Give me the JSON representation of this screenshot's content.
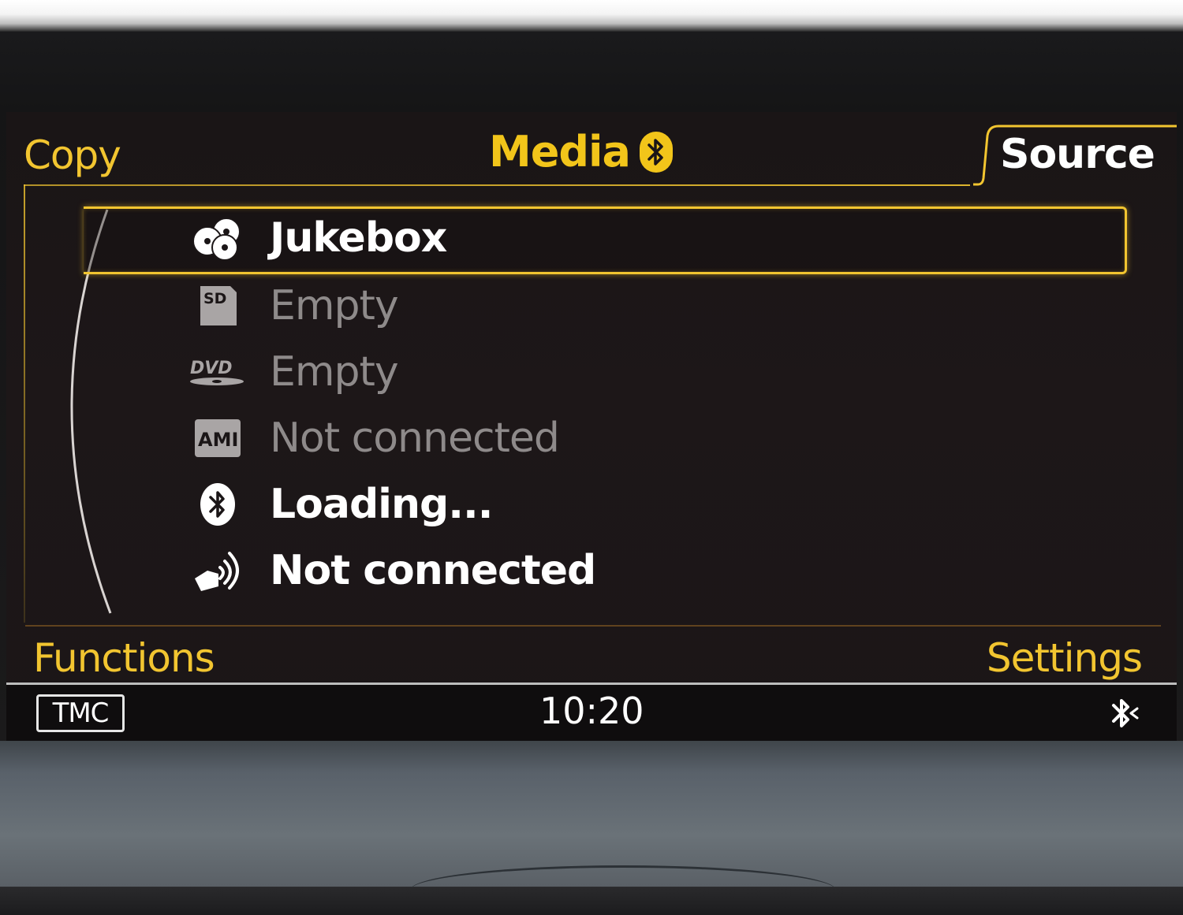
{
  "header": {
    "left_softkey": "Copy",
    "title": "Media",
    "right_tab": "Source"
  },
  "sources": [
    {
      "icon": "jukebox-discs-icon",
      "label": "Jukebox",
      "state": "selected"
    },
    {
      "icon": "sd-card-icon",
      "label": "Empty",
      "state": "disabled"
    },
    {
      "icon": "dvd-icon",
      "label": "Empty",
      "state": "disabled"
    },
    {
      "icon": "ami-icon",
      "label": "Not connected",
      "state": "disabled"
    },
    {
      "icon": "bluetooth-icon",
      "label": "Loading...",
      "state": "active"
    },
    {
      "icon": "aux-audio-icon",
      "label": "Not connected",
      "state": "active"
    }
  ],
  "icon_labels": {
    "sd": "SD",
    "dvd": "DVD",
    "ami": "AMI"
  },
  "footer": {
    "left_softkey": "Functions",
    "right_softkey": "Settings"
  },
  "status_bar": {
    "tmc": "TMC",
    "time": "10:20"
  },
  "colors": {
    "accent": "#f2c530",
    "text_active": "#ffffff",
    "text_disabled": "#8e8a8a",
    "background": "#1b1617"
  }
}
